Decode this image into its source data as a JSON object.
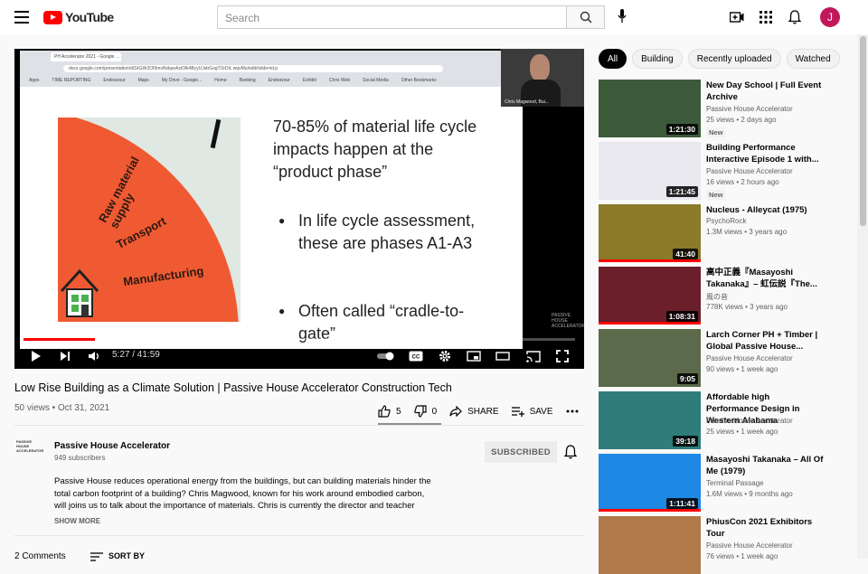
{
  "header": {
    "logo_text": "YouTube",
    "search_placeholder": "Search",
    "avatar_letter": "J"
  },
  "player": {
    "browser_tab": "PH Accelerator 2021 - Google ...",
    "browser_url": "docs.google.com/presentation/d/1kGilh2O0ImvNxkpeAziOlk4BcyUJsbGogTOrDiL wqvMu/edit#slide=id.p",
    "bookmarks": [
      "Apps",
      "TIME REPORTING",
      "Endeavour",
      "Maps",
      "My Drive - Google...",
      "Home",
      "Banking",
      "Endeavour",
      "Exhibit",
      "Chris Web",
      "Social Media",
      "Other Bookmarks"
    ],
    "slide": {
      "graphic_labels": [
        "Raw material supply",
        "Transport",
        "Manufacturing"
      ],
      "title": "70-85% of material life cycle impacts happen at the “product phase”",
      "bullets": [
        "In life cycle assessment, these are phases A1-A3",
        "Often called “cradle-to-gate”"
      ]
    },
    "webcam_name": "Chris Magwood, Bui...",
    "watermark": "PASSIVE HOUSE ACCELERATOR",
    "time": "5:27 / 41:59",
    "progress_fraction": 0.13
  },
  "video": {
    "title": "Low Rise Building as a Climate Solution | Passive House Accelerator Construction Tech",
    "meta": "50 views • Oct 31, 2021",
    "likes": "5",
    "dislikes": "0",
    "share_label": "SHARE",
    "save_label": "SAVE"
  },
  "channel": {
    "avatar_text": "PASSIVE HOUSE ACCELERATOR",
    "name": "Passive House Accelerator",
    "subscribers": "949 subscribers",
    "subscribed_label": "SUBSCRIBED",
    "description": "Passive House reduces operational energy from the buildings, but can building materials hinder the total carbon footprint of a building? Chris Magwood, known for his work around embodied carbon, will joins us  to talk about the importance of materials. Chris is currently the director and teacher",
    "show_more": "SHOW MORE"
  },
  "comments": {
    "count_label": "2 Comments",
    "sort_label": "SORT BY"
  },
  "chips": [
    "All",
    "Building",
    "Recently uploaded",
    "Watched"
  ],
  "recommendations": [
    {
      "title": "New Day School | Full Event Archive",
      "channel": "Passive House Accelerator",
      "meta": "25 views • 2 days ago",
      "badge": "New",
      "duration": "1:21:30",
      "thumb_color": "#3c5a3a",
      "watched": 0
    },
    {
      "title": "Building Performance Interactive Episode 1 with...",
      "channel": "Passive House Accelerator",
      "meta": "16 views • 2 hours ago",
      "badge": "New",
      "duration": "1:21:45",
      "thumb_color": "#e8e8ee",
      "watched": 0
    },
    {
      "title": "Nucleus - Alleycat (1975)",
      "channel": "PsychoRock",
      "meta": "1.3M views • 3 years ago",
      "badge": "",
      "duration": "41:40",
      "thumb_color": "#8a7a2a",
      "watched": 1
    },
    {
      "title": "高中正義『Masayoshi Takanaka』– 虹伝説『The...",
      "channel": "風の音",
      "meta": "778K views • 3 years ago",
      "badge": "",
      "duration": "1:08:31",
      "thumb_color": "#6a1f2a",
      "watched": 1
    },
    {
      "title": "Larch Corner PH + Timber | Global Passive House...",
      "channel": "Passive House Accelerator",
      "meta": "90 views • 1 week ago",
      "badge": "",
      "duration": "9:05",
      "thumb_color": "#5a6a4a",
      "watched": 0
    },
    {
      "title": "Affordable high Performance Design in Western Alabama",
      "channel": "Passive House Accelerator",
      "meta": "25 views • 1 week ago",
      "badge": "",
      "duration": "39:18",
      "thumb_color": "#2e7d7a",
      "watched": 0
    },
    {
      "title": "Masayoshi Takanaka – All Of Me (1979)",
      "channel": "Terminal Passage",
      "meta": "1.6M views • 9 months ago",
      "badge": "",
      "duration": "1:11:41",
      "thumb_color": "#1e88e5",
      "watched": 1
    },
    {
      "title": "PhiusCon 2021 Exhibitors Tour",
      "channel": "Passive House Accelerator",
      "meta": "76 views • 1 week ago",
      "badge": "",
      "duration": "",
      "thumb_color": "#b07a4a",
      "watched": 0
    }
  ]
}
